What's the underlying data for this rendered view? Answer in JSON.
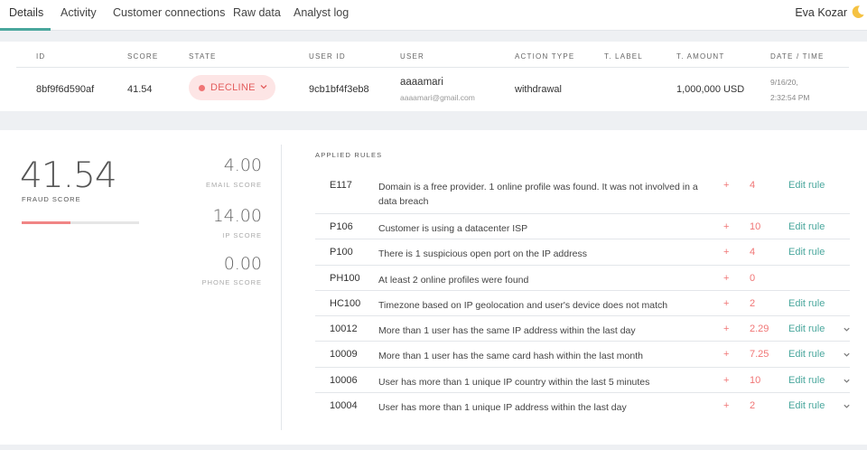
{
  "nav": {
    "tabs": [
      {
        "label": "Details"
      },
      {
        "label": "Activity"
      },
      {
        "label": "Customer connections"
      },
      {
        "label": "Raw data"
      },
      {
        "label": "Analyst log"
      }
    ],
    "active_tab": "Details",
    "user_name": "Eva Kozar",
    "avatar_icon": "crescent-avatar-icon",
    "accent": "#4aa79d"
  },
  "summary": {
    "headers": {
      "id": "ID",
      "score": "SCORE",
      "state": "STATE",
      "user_id": "USER ID",
      "user": "USER",
      "action_type": "ACTION TYPE",
      "t_label": "T. LABEL",
      "t_amount": "T. AMOUNT",
      "date_time": "DATE / TIME"
    },
    "row": {
      "id": "8bf9f6d590af",
      "score": "41.54",
      "state": "DECLINE",
      "user_id": "9cb1bf4f3eb8",
      "user_name": "aaaamari",
      "user_email": "aaaamari@gmail.com",
      "action_type": "withdrawal",
      "t_label": "",
      "t_amount": "1,000,000 USD",
      "date_line1": "9/16/20,",
      "date_line2": "2:32:54 PM"
    },
    "state_color": "#e35d5d"
  },
  "scores": {
    "fraud_score": "41.54",
    "fraud_label": "FRAUD SCORE",
    "fraud_fraction": 0.4154,
    "email_score": "4.00",
    "email_label": "EMAIL SCORE",
    "ip_score": "14.00",
    "ip_label": "IP SCORE",
    "phone_score": "0.00",
    "phone_label": "PHONE SCORE"
  },
  "rules": {
    "title": "APPLIED RULES",
    "edit_label": "Edit rule",
    "items": [
      {
        "code": "E117",
        "description": "Domain is a free provider. 1 online profile was found. It was not involved in a data breach",
        "sign": "+",
        "points": "4",
        "editable": true,
        "expandable": false
      },
      {
        "code": "P106",
        "description": "Customer is using a datacenter ISP",
        "sign": "+",
        "points": "10",
        "editable": true,
        "expandable": false
      },
      {
        "code": "P100",
        "description": "There is 1 suspicious open port on the IP address",
        "sign": "+",
        "points": "4",
        "editable": true,
        "expandable": false
      },
      {
        "code": "PH100",
        "description": "At least 2 online profiles were found",
        "sign": "+",
        "points": "0",
        "editable": false,
        "expandable": false
      },
      {
        "code": "HC100",
        "description": "Timezone based on IP geolocation and user's device does not match",
        "sign": "+",
        "points": "2",
        "editable": true,
        "expandable": false
      },
      {
        "code": "10012",
        "description": "More than 1 user has the same IP address within the last day",
        "sign": "+",
        "points": "2.29",
        "editable": true,
        "expandable": true
      },
      {
        "code": "10009",
        "description": "More than 1 user has the same card hash within the last month",
        "sign": "+",
        "points": "7.25",
        "editable": true,
        "expandable": true
      },
      {
        "code": "10006",
        "description": "User has more than 1 unique IP country within the last 5 minutes",
        "sign": "+",
        "points": "10",
        "editable": true,
        "expandable": true
      },
      {
        "code": "10004",
        "description": "User has more than 1 unique IP address within the last day",
        "sign": "+",
        "points": "2",
        "editable": true,
        "expandable": true
      }
    ]
  }
}
